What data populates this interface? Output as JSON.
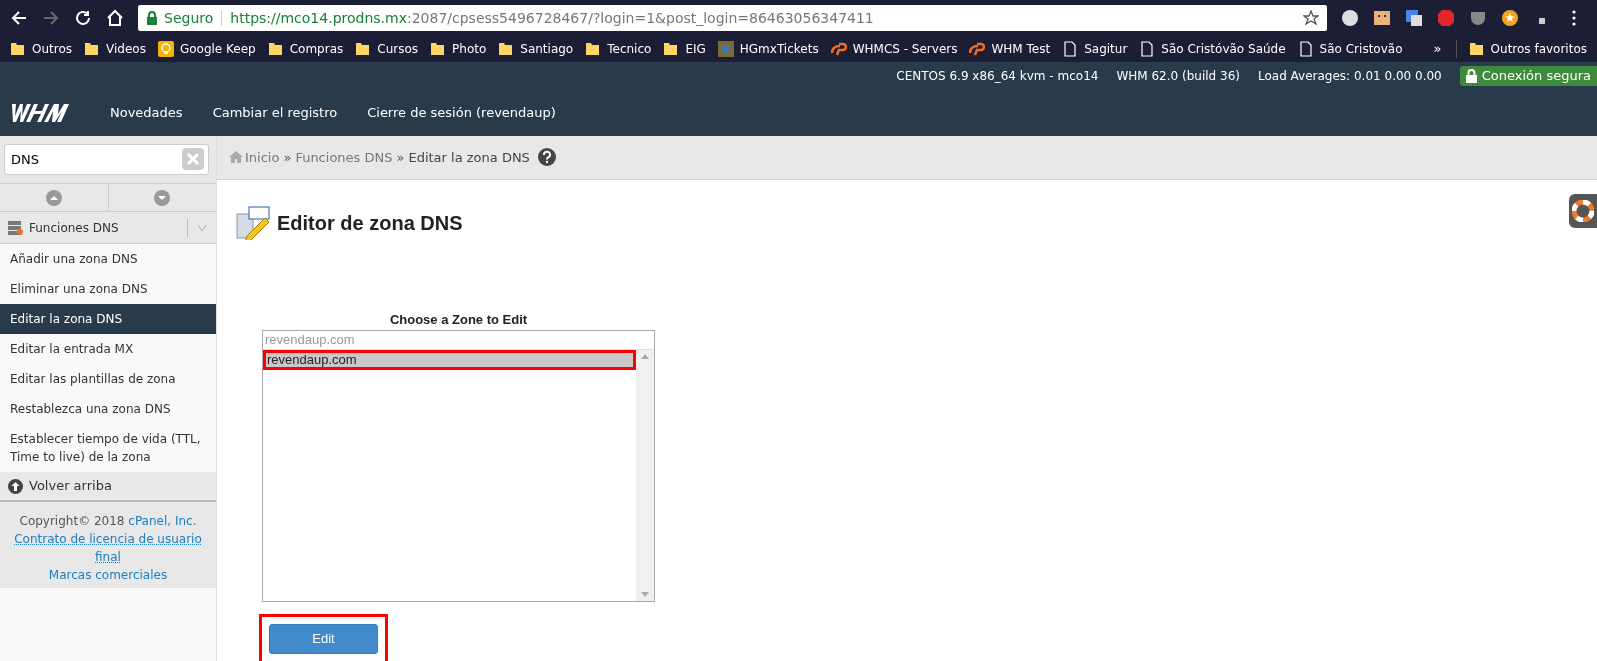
{
  "browser": {
    "secure_label": "Seguro",
    "url_host": "https://mco14.prodns.mx",
    "url_rest": ":2087/cpsess5496728467/?login=1&post_login=86463056347411",
    "bookmarks": [
      {
        "kind": "folder",
        "label": "Outros"
      },
      {
        "kind": "folder",
        "label": "Videos"
      },
      {
        "kind": "keep",
        "label": "Google Keep"
      },
      {
        "kind": "folder",
        "label": "Compras"
      },
      {
        "kind": "folder",
        "label": "Cursos"
      },
      {
        "kind": "folder",
        "label": "Photo"
      },
      {
        "kind": "folder",
        "label": "Santiago"
      },
      {
        "kind": "folder",
        "label": "Tecnico"
      },
      {
        "kind": "folder",
        "label": "EIG"
      },
      {
        "kind": "image",
        "label": "HGmxTickets"
      },
      {
        "kind": "cpanel",
        "label": "WHMCS - Servers"
      },
      {
        "kind": "cpanel",
        "label": "WHM Test"
      },
      {
        "kind": "page",
        "label": "Sagitur"
      },
      {
        "kind": "page",
        "label": "São Cristóvão Saúde"
      },
      {
        "kind": "page",
        "label": "São Cristovão"
      }
    ],
    "overflow": "»",
    "other_bookmarks": "Outros favoritos"
  },
  "header": {
    "server_info": "CENTOS 6.9 x86_64 kvm - mco14",
    "version": "WHM 62.0 (build 36)",
    "load": "Load Averages: 0.01 0.00 0.00",
    "secure": "Conexión segura",
    "nav": [
      "Novedades",
      "Cambiar el registro",
      "Cierre de sesión (revendaup)"
    ]
  },
  "sidebar": {
    "search": "DNS",
    "group": "Funciones DNS",
    "items": [
      {
        "label": "Añadir una zona DNS",
        "selected": false
      },
      {
        "label": "Eliminar una zona DNS",
        "selected": false
      },
      {
        "label": "Editar la zona DNS",
        "selected": true
      },
      {
        "label": "Editar la entrada MX",
        "selected": false
      },
      {
        "label": "Editar las plantillas de zona",
        "selected": false
      },
      {
        "label": "Restablezca una zona DNS",
        "selected": false
      },
      {
        "label": "Establecer tiempo de vida (TTL, Time to live) de la zona",
        "selected": false
      }
    ],
    "back_to_top": "Volver arriba",
    "copyright": "Copyright© 2018",
    "company": "cPanel, Inc.",
    "license": "Contrato de licencia de usuario final",
    "trademarks": "Marcas comerciales"
  },
  "breadcrumb": [
    "Inicio",
    "Funciones DNS",
    "Editar la zona DNS"
  ],
  "breadcrumb_separator": "»",
  "page": {
    "title": "Editor de zona DNS",
    "zone_label": "Choose a Zone to Edit",
    "filter_placeholder": "revendaup.com",
    "zones": [
      {
        "label": "revendaup.com",
        "selected": true,
        "highlighted": true
      }
    ],
    "edit_button": {
      "label": "Edit",
      "highlighted": true
    }
  }
}
